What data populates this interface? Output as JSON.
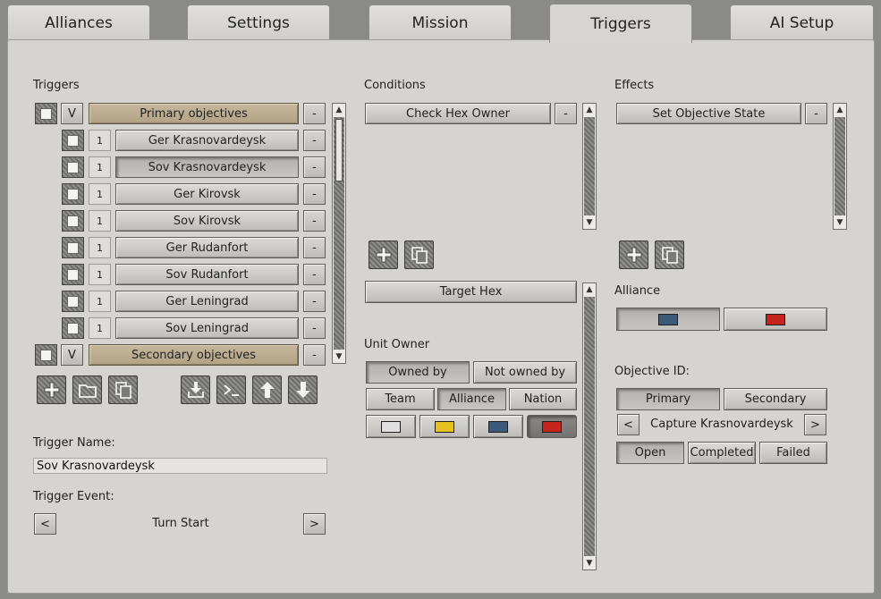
{
  "tabs": [
    "Alliances",
    "Settings",
    "Mission",
    "Triggers",
    "AI Setup"
  ],
  "triggers": {
    "label": "Triggers",
    "groups": [
      {
        "toggle": "V",
        "name": "Primary objectives",
        "remove": "-"
      },
      {
        "toggle": "V",
        "name": "Secondary objectives",
        "remove": "-"
      }
    ],
    "items": [
      {
        "num": "1",
        "name": "Ger Krasnovardeysk",
        "remove": "-"
      },
      {
        "num": "1",
        "name": "Sov Krasnovardeysk",
        "remove": "-"
      },
      {
        "num": "1",
        "name": "Ger Kirovsk",
        "remove": "-"
      },
      {
        "num": "1",
        "name": "Sov Kirovsk",
        "remove": "-"
      },
      {
        "num": "1",
        "name": "Ger Rudanfort",
        "remove": "-"
      },
      {
        "num": "1",
        "name": "Sov Rudanfort",
        "remove": "-"
      },
      {
        "num": "1",
        "name": "Ger Leningrad",
        "remove": "-"
      },
      {
        "num": "1",
        "name": "Sov Leningrad",
        "remove": "-"
      }
    ],
    "toolbar": [
      "plus-icon",
      "folder-icon",
      "copy-icon",
      "import-icon",
      "console-icon",
      "arrow-up-icon",
      "arrow-down-icon"
    ],
    "name_label": "Trigger Name:",
    "name_value": "Sov Krasnovardeysk",
    "event_label": "Trigger Event:",
    "event_value": "Turn Start",
    "prev": "<",
    "next": ">"
  },
  "conditions": {
    "label": "Conditions",
    "item": "Check Hex Owner",
    "remove": "-",
    "target_hex": "Target Hex",
    "unit_owner_label": "Unit Owner",
    "owned_by": "Owned by",
    "not_owned_by": "Not owned by",
    "team": "Team",
    "alliance": "Alliance",
    "nation": "Nation",
    "colors": [
      "#e0e0e0",
      "#e8c21c",
      "#3e5a7a",
      "#c4241c"
    ]
  },
  "effects": {
    "label": "Effects",
    "item": "Set Objective State",
    "remove": "-",
    "alliance_label": "Alliance",
    "alliance_colors": [
      "#3e5a7a",
      "#c4241c"
    ],
    "objective_label": "Objective ID:",
    "primary": "Primary",
    "secondary": "Secondary",
    "prev": "<",
    "next": ">",
    "objective_value": "Capture Krasnovardeysk",
    "open": "Open",
    "completed": "Completed",
    "failed": "Failed"
  }
}
